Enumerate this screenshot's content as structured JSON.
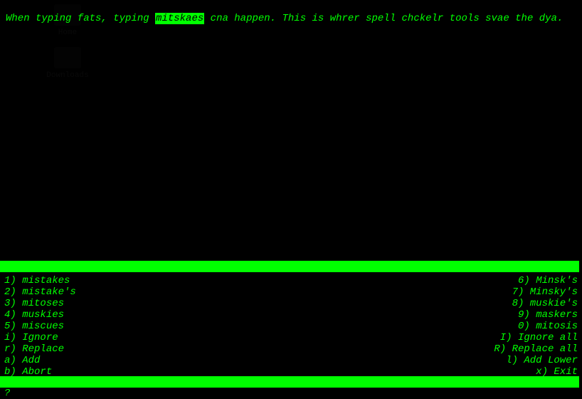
{
  "desktop": {
    "icon1_label": "Home",
    "icon2_label": "Downloads"
  },
  "text": {
    "pre": "When typing fats, typing ",
    "highlight": "mitskaes",
    "post": " cna happen. This is whrer spell chckelr tools svae the dya."
  },
  "suggestions_left": [
    {
      "key": "1)",
      "word": "mistakes"
    },
    {
      "key": "2)",
      "word": "mistake's"
    },
    {
      "key": "3)",
      "word": "mitoses"
    },
    {
      "key": "4)",
      "word": "muskies"
    },
    {
      "key": "5)",
      "word": "miscues"
    }
  ],
  "suggestions_right": [
    {
      "key": "6)",
      "word": "Minsk's"
    },
    {
      "key": "7)",
      "word": "Minsky's"
    },
    {
      "key": "8)",
      "word": "muskie's"
    },
    {
      "key": "9)",
      "word": "maskers"
    },
    {
      "key": "0)",
      "word": "mitosis"
    }
  ],
  "commands_left": [
    {
      "key": "i)",
      "label": "Ignore"
    },
    {
      "key": "r)",
      "label": "Replace"
    },
    {
      "key": "a)",
      "label": "Add"
    },
    {
      "key": "b)",
      "label": "Abort"
    }
  ],
  "commands_right": [
    {
      "key": "I)",
      "label": "Ignore all"
    },
    {
      "key": "R)",
      "label": "Replace all"
    },
    {
      "key": "l)",
      "label": "Add Lower"
    },
    {
      "key": "x)",
      "label": "Exit"
    }
  ],
  "prompt": "?"
}
